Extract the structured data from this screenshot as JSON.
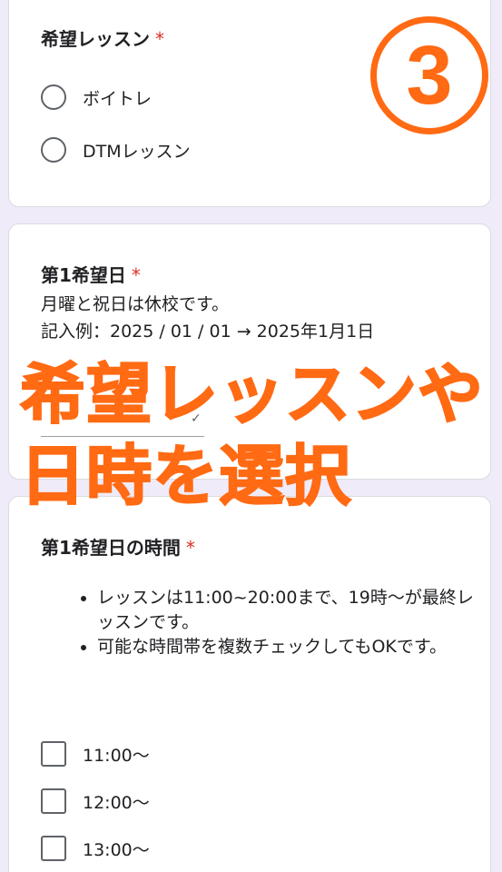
{
  "lesson_question": {
    "title": "希望レッスン",
    "required_mark": "*",
    "options": [
      "ボイトレ",
      "DTMレッスン"
    ]
  },
  "first_date_question": {
    "title": "第1希望日",
    "required_mark": "*",
    "description_line1": "月曜と祝日は休校です。",
    "description_line2": "記入例：2025 / 01 / 01 → 2025年1月1日"
  },
  "first_time_question": {
    "title": "第1希望日の時間",
    "required_mark": "*",
    "notes": [
      "レッスンは11:00~20:00まで、19時〜が最終レッスンです。",
      "可能な時間帯を複数チェックしてもOKです。"
    ],
    "options": [
      "11:00〜",
      "12:00〜",
      "13:00〜"
    ]
  },
  "overlay": {
    "badge": "3",
    "line1": "希望レッスンや",
    "line2": "日時を選択"
  },
  "colors": {
    "accent": "#ff6a13",
    "required": "#d93025",
    "background": "#f0ebf8"
  }
}
